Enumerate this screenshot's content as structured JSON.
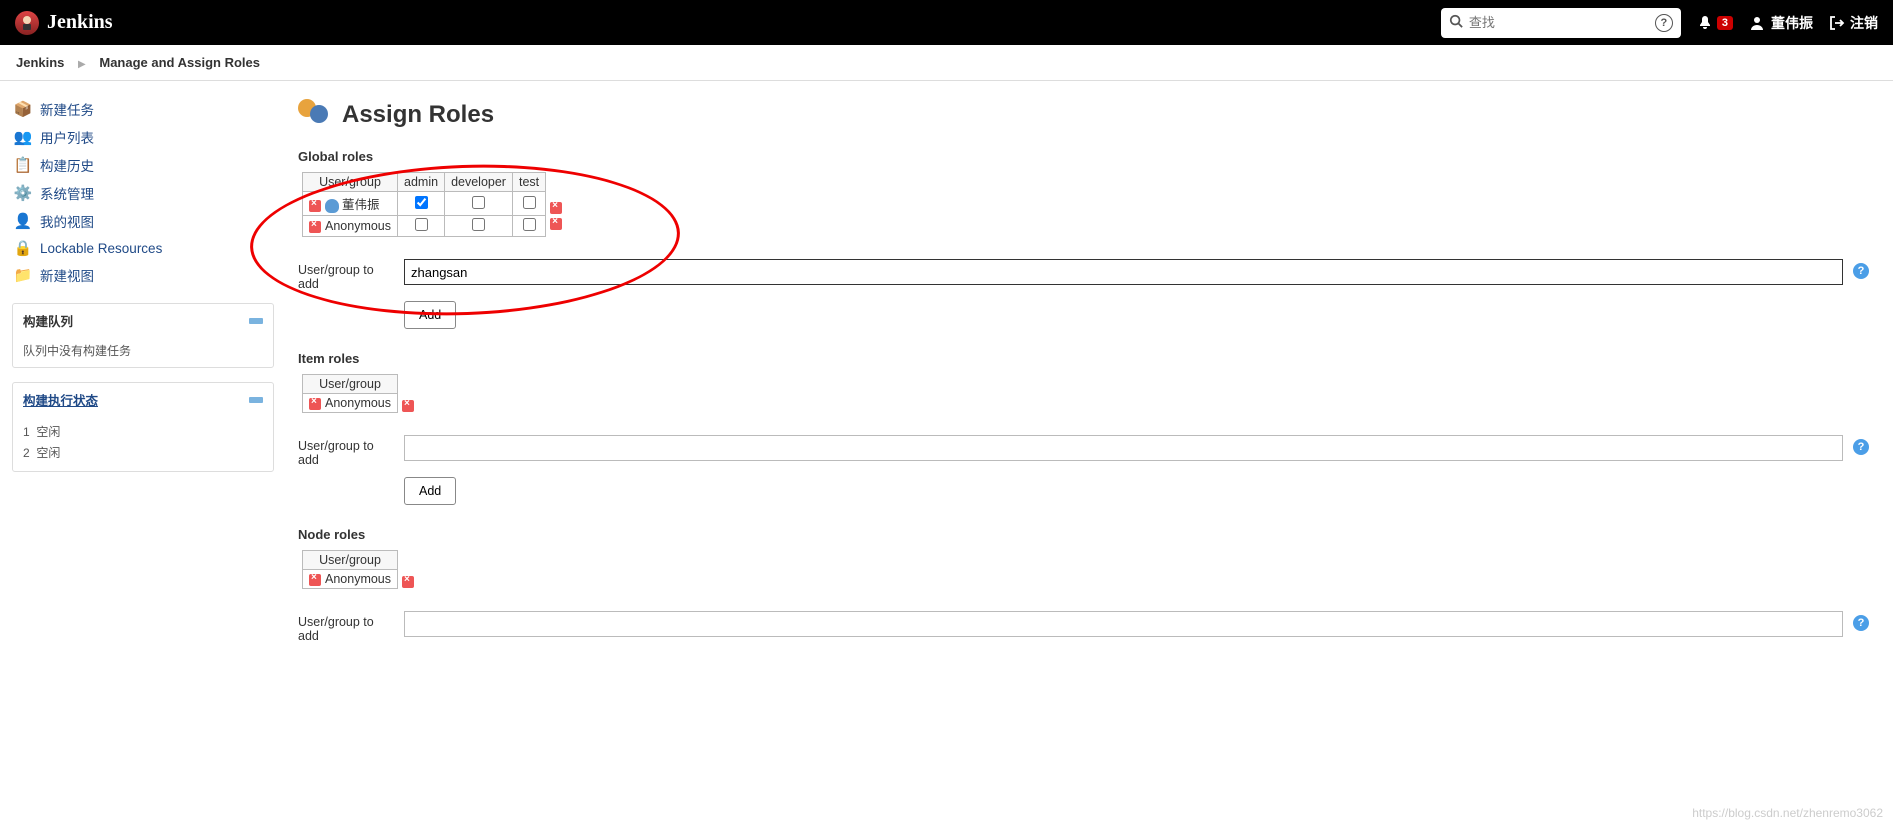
{
  "header": {
    "logo_text": "Jenkins",
    "search_placeholder": "查找",
    "notification_count": "3",
    "username": "董伟振",
    "logout_label": "注销"
  },
  "breadcrumb": {
    "items": [
      "Jenkins",
      "Manage and Assign Roles"
    ]
  },
  "sidebar": {
    "links": [
      {
        "label": "新建任务",
        "icon": "📦"
      },
      {
        "label": "用户列表",
        "icon": "👥"
      },
      {
        "label": "构建历史",
        "icon": "📋"
      },
      {
        "label": "系统管理",
        "icon": "⚙️"
      },
      {
        "label": "我的视图",
        "icon": "👤"
      },
      {
        "label": "Lockable Resources",
        "icon": "🔒"
      },
      {
        "label": "新建视图",
        "icon": "📁"
      }
    ],
    "queue": {
      "title": "构建队列",
      "empty_text": "队列中没有构建任务"
    },
    "executor": {
      "title": "构建执行状态",
      "rows": [
        {
          "num": "1",
          "state": "空闲"
        },
        {
          "num": "2",
          "state": "空闲"
        }
      ]
    }
  },
  "main": {
    "title": "Assign Roles",
    "global": {
      "heading": "Global roles",
      "header_usergroup": "User/group",
      "columns": [
        "admin",
        "developer",
        "test"
      ],
      "rows": [
        {
          "name": "董伟振",
          "has_icon": true,
          "checks": [
            true,
            false,
            false
          ]
        },
        {
          "name": "Anonymous",
          "has_icon": false,
          "checks": [
            false,
            false,
            false
          ]
        }
      ],
      "add_label": "User/group to add",
      "add_value": "zhangsan",
      "add_button": "Add"
    },
    "item": {
      "heading": "Item roles",
      "header_usergroup": "User/group",
      "rows": [
        {
          "name": "Anonymous"
        }
      ],
      "add_label": "User/group to add",
      "add_value": "",
      "add_button": "Add"
    },
    "node": {
      "heading": "Node roles",
      "header_usergroup": "User/group",
      "rows": [
        {
          "name": "Anonymous"
        }
      ],
      "add_label": "User/group to add",
      "add_value": ""
    }
  },
  "watermark": "https://blog.csdn.net/zhenremo3062"
}
